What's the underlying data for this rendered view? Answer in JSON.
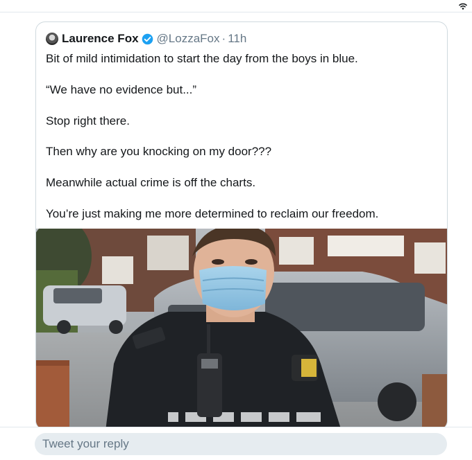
{
  "status_bar": {
    "icon": "wifi-icon"
  },
  "quoted_tweet": {
    "display_name": "Laurence Fox",
    "verified": true,
    "handle": "@LozzaFox",
    "separator": "·",
    "time": "11h",
    "lines": [
      "Bit of mild intimidation to start the day from the boys in blue.",
      "“We have no evidence but...”",
      "Stop right there.",
      "Then why are you knocking on my door???",
      "Meanwhile actual crime is off the charts.",
      "You’re just making me more determined to reclaim our freedom."
    ]
  },
  "reply": {
    "placeholder": "Tweet your reply"
  },
  "colors": {
    "verified": "#1da1f2",
    "secondary_text": "#657786",
    "reply_bg": "#e6ecf0",
    "card_border": "#cfd9de"
  }
}
